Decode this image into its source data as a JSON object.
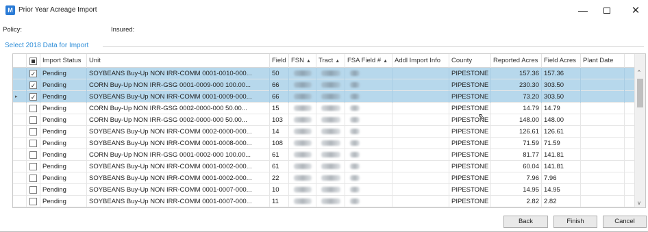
{
  "window": {
    "icon_letter": "M",
    "title": "Prior Year Acreage Import",
    "minimize_glyph": "—",
    "close_glyph": "✕"
  },
  "policy": {
    "label": "Policy:",
    "insured_label": "Insured:"
  },
  "section_title": "Select 2018 Data for Import",
  "columns": {
    "status": "Import Status",
    "unit": "Unit",
    "field": "Field",
    "fsn": "FSN",
    "tract": "Tract",
    "fsa_field": "FSA Field #",
    "addl_info": "Addl Import Info",
    "county": "County",
    "reported_acres": "Reported Acres",
    "field_acres": "Field Acres",
    "plant_date": "Plant Date"
  },
  "rows": [
    {
      "checked": true,
      "selected": true,
      "status": "Pending",
      "unit": "SOYBEANS  Buy-Up  NON IRR-COMM  0001-0010-000...",
      "field": "50",
      "county": "PIPESTONE",
      "reported": "157.36",
      "field_acres": "157.36"
    },
    {
      "checked": true,
      "selected": true,
      "status": "Pending",
      "unit": "CORN  Buy-Up  NON IRR-GSG  0001-0009-000  100.00...",
      "field": "66",
      "county": "PIPESTONE",
      "reported": "230.30",
      "field_acres": "303.50"
    },
    {
      "checked": true,
      "selected": true,
      "status": "Pending",
      "unit": "SOYBEANS  Buy-Up  NON IRR-COMM  0001-0009-000...",
      "field": "66",
      "county": "PIPESTONE",
      "reported": "73.20",
      "field_acres": "303.50"
    },
    {
      "checked": false,
      "selected": false,
      "status": "Pending",
      "unit": "CORN  Buy-Up  NON IRR-GSG  0002-0000-000  50.00...",
      "field": "15",
      "county": "PIPESTONE",
      "reported": "14.79",
      "field_acres": "14.79"
    },
    {
      "checked": false,
      "selected": false,
      "status": "Pending",
      "unit": "CORN  Buy-Up  NON IRR-GSG  0002-0000-000  50.00...",
      "field": "103",
      "county": "PIPESTONE",
      "reported": "148.00",
      "field_acres": "148.00"
    },
    {
      "checked": false,
      "selected": false,
      "status": "Pending",
      "unit": "SOYBEANS  Buy-Up  NON IRR-COMM  0002-0000-000...",
      "field": "14",
      "county": "PIPESTONE",
      "reported": "126.61",
      "field_acres": "126.61"
    },
    {
      "checked": false,
      "selected": false,
      "status": "Pending",
      "unit": "SOYBEANS  Buy-Up  NON IRR-COMM  0001-0008-000...",
      "field": "108",
      "county": "PIPESTONE",
      "reported": "71.59",
      "field_acres": "71.59"
    },
    {
      "checked": false,
      "selected": false,
      "status": "Pending",
      "unit": "CORN  Buy-Up  NON IRR-GSG  0001-0002-000  100.00...",
      "field": "61",
      "county": "PIPESTONE",
      "reported": "81.77",
      "field_acres": "141.81"
    },
    {
      "checked": false,
      "selected": false,
      "status": "Pending",
      "unit": "SOYBEANS  Buy-Up  NON IRR-COMM  0001-0002-000...",
      "field": "61",
      "county": "PIPESTONE",
      "reported": "60.04",
      "field_acres": "141.81"
    },
    {
      "checked": false,
      "selected": false,
      "status": "Pending",
      "unit": "SOYBEANS  Buy-Up  NON IRR-COMM  0001-0002-000...",
      "field": "22",
      "county": "PIPESTONE",
      "reported": "7.96",
      "field_acres": "7.96"
    },
    {
      "checked": false,
      "selected": false,
      "status": "Pending",
      "unit": "SOYBEANS  Buy-Up  NON IRR-COMM  0001-0007-000...",
      "field": "10",
      "county": "PIPESTONE",
      "reported": "14.95",
      "field_acres": "14.95"
    },
    {
      "checked": false,
      "selected": false,
      "status": "Pending",
      "unit": "SOYBEANS  Buy-Up  NON IRR-COMM  0001-0007-000...",
      "field": "11",
      "county": "PIPESTONE",
      "reported": "2.82",
      "field_acres": "2.82"
    }
  ],
  "buttons": {
    "back": "Back",
    "finish": "Finish",
    "cancel": "Cancel"
  },
  "colors": {
    "accent": "#2f8ed8",
    "selected_row": "#b7d8ec",
    "app_icon": "#2a7bd6"
  }
}
